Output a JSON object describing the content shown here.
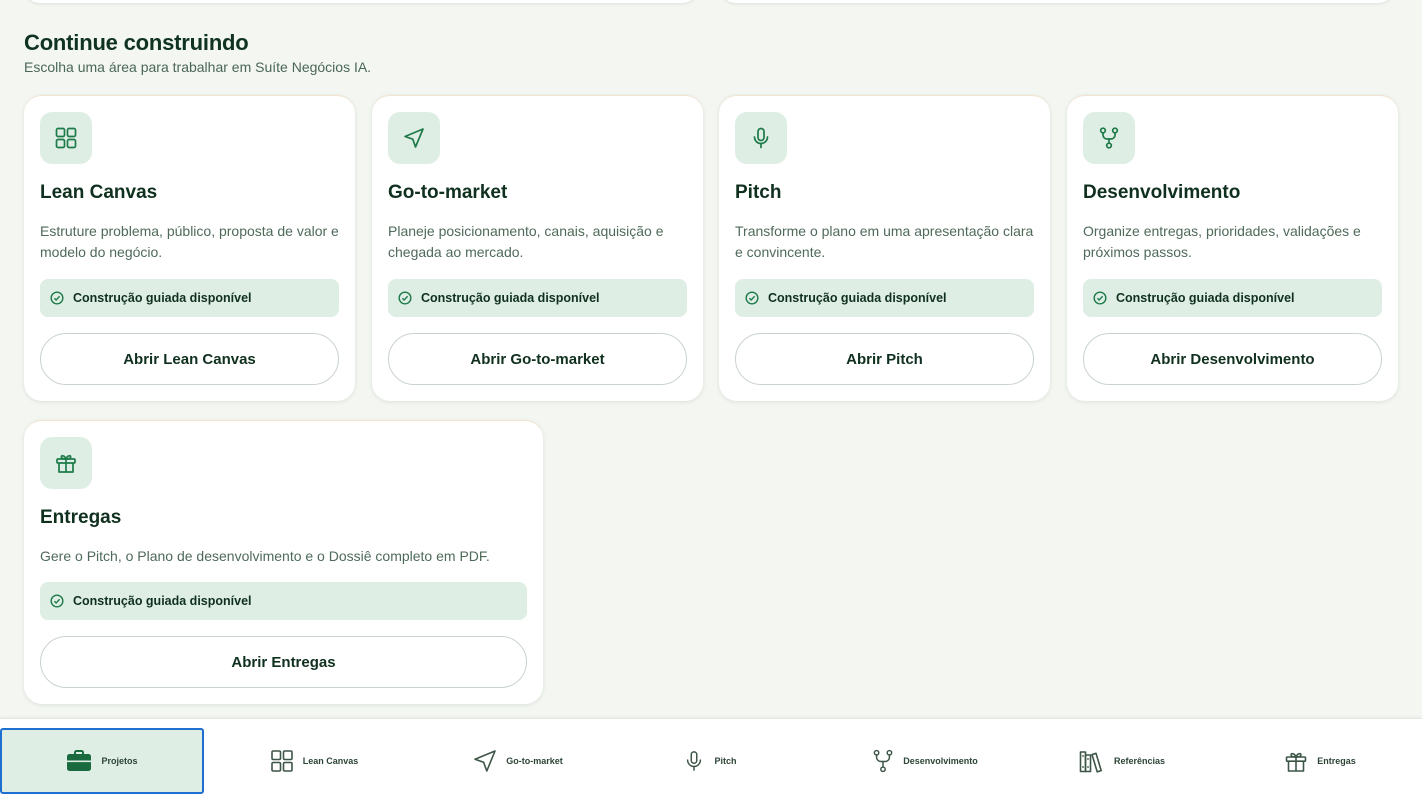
{
  "section": {
    "title": "Continue construindo",
    "subtitle": "Escolha uma área para trabalhar em Suíte Negócios IA."
  },
  "cards": [
    {
      "title": "Lean Canvas",
      "description": "Estruture problema, público, proposta de valor e modelo do negócio.",
      "badge": "Construção guiada disponível",
      "button": "Abrir Lean Canvas",
      "icon": "grid-icon"
    },
    {
      "title": "Go-to-market",
      "description": "Planeje posicionamento, canais, aquisição e chegada ao mercado.",
      "badge": "Construção guiada disponível",
      "button": "Abrir Go-to-market",
      "icon": "navigation-arrow-icon"
    },
    {
      "title": "Pitch",
      "description": "Transforme o plano em uma apresentação clara e convincente.",
      "badge": "Construção guiada disponível",
      "button": "Abrir Pitch",
      "icon": "microphone-icon"
    },
    {
      "title": "Desenvolvimento",
      "description": "Organize entregas, prioridades, validações e próximos passos.",
      "badge": "Construção guiada disponível",
      "button": "Abrir Desenvolvimento",
      "icon": "git-branch-icon"
    },
    {
      "title": "Entregas",
      "description": "Gere o Pitch, o Plano de desenvolvimento e o Dossiê completo em PDF.",
      "badge": "Construção guiada disponível",
      "button": "Abrir Entregas",
      "icon": "gift-icon"
    }
  ],
  "nav": {
    "active": "Projetos",
    "items": [
      {
        "label": "Projetos",
        "icon": "briefcase-icon"
      },
      {
        "label": "Lean Canvas",
        "icon": "grid-icon"
      },
      {
        "label": "Go-to-market",
        "icon": "navigation-arrow-icon"
      },
      {
        "label": "Pitch",
        "icon": "microphone-icon"
      },
      {
        "label": "Desenvolvimento",
        "icon": "git-branch-icon"
      },
      {
        "label": "Referências",
        "icon": "library-icon"
      },
      {
        "label": "Entregas",
        "icon": "gift-icon"
      }
    ]
  },
  "colors": {
    "background": "#f3f6f1",
    "accent": "#1f7a4a",
    "badge_bg": "#deeee4",
    "text_dark": "#10301f",
    "active_outline": "#1f6fd1"
  }
}
